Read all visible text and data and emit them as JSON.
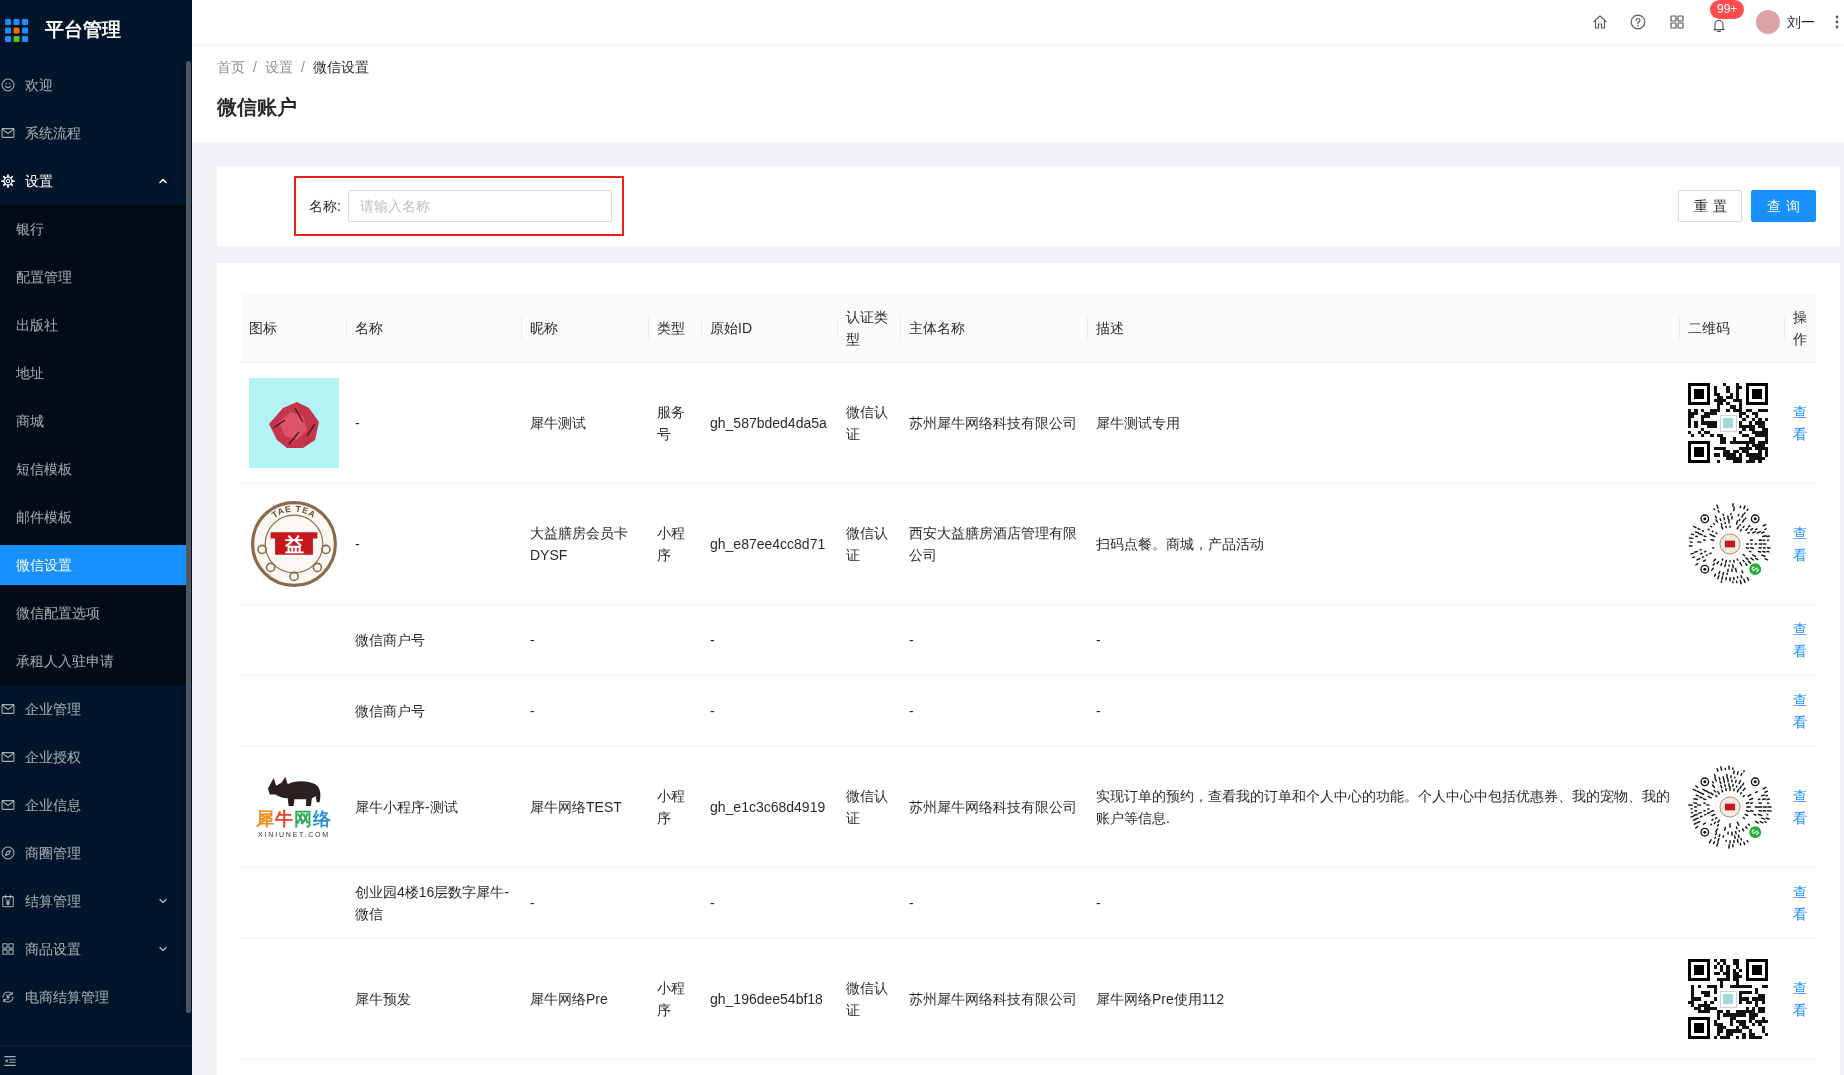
{
  "header": {
    "notification_count": "99+",
    "user_name": "刘一"
  },
  "sidebar": {
    "title": "平台管理",
    "items": [
      {
        "label": "欢迎",
        "kind": "item",
        "selected": false
      },
      {
        "label": "系统流程",
        "kind": "item",
        "selected": false
      },
      {
        "label": "设置",
        "kind": "submenu",
        "expanded": true,
        "children": [
          {
            "label": "银行",
            "selected": false
          },
          {
            "label": "配置管理",
            "selected": false
          },
          {
            "label": "出版社",
            "selected": false
          },
          {
            "label": "地址",
            "selected": false
          },
          {
            "label": "商城",
            "selected": false
          },
          {
            "label": "短信模板",
            "selected": false
          },
          {
            "label": "邮件模板",
            "selected": false
          },
          {
            "label": "微信设置",
            "selected": true
          },
          {
            "label": "微信配置选项",
            "selected": false
          },
          {
            "label": "承租人入驻申请",
            "selected": false
          }
        ]
      },
      {
        "label": "企业管理",
        "kind": "item",
        "selected": false
      },
      {
        "label": "企业授权",
        "kind": "item",
        "selected": false
      },
      {
        "label": "企业信息",
        "kind": "item",
        "selected": false
      },
      {
        "label": "商圈管理",
        "kind": "item",
        "selected": false
      },
      {
        "label": "结算管理",
        "kind": "submenu",
        "expanded": false
      },
      {
        "label": "商品设置",
        "kind": "submenu",
        "expanded": false
      },
      {
        "label": "电商结算管理",
        "kind": "item",
        "selected": false
      }
    ]
  },
  "breadcrumb": [
    {
      "label": "首页",
      "separator": "/",
      "current": false
    },
    {
      "label": "设置",
      "separator": "/",
      "current": false
    },
    {
      "label": "微信设置",
      "current": true
    }
  ],
  "page_title": "微信账户",
  "search": {
    "label": "名称:",
    "placeholder": "请输入名称",
    "highlighted": true
  },
  "buttons": [
    {
      "label": "重置",
      "kind": "default"
    },
    {
      "label": "查询",
      "kind": "primary"
    }
  ],
  "table": {
    "columns": [
      "图标",
      "名称",
      "昵称",
      "类型",
      "原始ID",
      "认证类型",
      "主体名称",
      "描述",
      "二维码",
      "操作"
    ],
    "rows": [
      {
        "icon": {
          "kind": "photo"
        },
        "name": "-",
        "nickname": "犀牛测试",
        "type": "服务号",
        "original_id": "gh_587bded4da5a",
        "verification": "微信认证",
        "entity": "苏州犀牛网络科技有限公司",
        "description": "犀牛测试专用",
        "qr_code": {
          "kind": "square"
        },
        "action": "查看"
      },
      {
        "icon": {
          "kind": "seal",
          "ring_text": "TAE TEA",
          "center_text": "益"
        },
        "name": "-",
        "nickname": "大益膳房会员卡DYSF",
        "type": "小程序",
        "original_id": "gh_e87ee4cc8d71",
        "verification": "微信认证",
        "entity": "西安大益膳房酒店管理有限公司",
        "description": "扫码点餐。商城，产品活动",
        "qr_code": {
          "kind": "round"
        },
        "action": "查看"
      },
      {
        "name": "微信商户号",
        "nickname": "-",
        "original_id": "-",
        "entity": "-",
        "description": "-",
        "action": "查看"
      },
      {
        "name": "微信商户号",
        "nickname": "-",
        "original_id": "-",
        "entity": "-",
        "description": "-",
        "action": "查看"
      },
      {
        "icon": {
          "kind": "brand",
          "title": "犀牛网络",
          "subtitle": "XINIUNET.COM"
        },
        "name": "犀牛小程序-测试",
        "nickname": "犀牛网络TEST",
        "type": "小程序",
        "original_id": "gh_e1c3c68d4919",
        "verification": "微信认证",
        "entity": "苏州犀牛网络科技有限公司",
        "description": "实现订单的预约，查看我的订单和个人中心的功能。个人中心中包括优惠券、我的宠物、我的账户等信息.",
        "qr_code": {
          "kind": "round"
        },
        "action": "查看"
      },
      {
        "name": "创业园4楼16层数字犀牛-微信",
        "nickname": "-",
        "original_id": "-",
        "entity": "-",
        "description": "-",
        "action": "查看"
      },
      {
        "name": "犀牛预发",
        "nickname": "犀牛网络Pre",
        "type": "小程序",
        "original_id": "gh_196dee54bf18",
        "verification": "微信认证",
        "entity": "苏州犀牛网络科技有限公司",
        "description": "犀牛网络Pre使用112",
        "qr_code": {
          "kind": "square"
        },
        "action": "查看"
      }
    ]
  }
}
